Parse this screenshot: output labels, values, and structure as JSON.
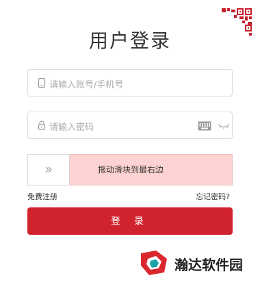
{
  "page": {
    "title": "用户登录"
  },
  "form": {
    "account_placeholder": "请输入账号/手机号",
    "password_placeholder": "请输入密码"
  },
  "slider": {
    "hint": "拖动滑块到最右边"
  },
  "links": {
    "register": "免费注册",
    "forgot": "忘记密码?"
  },
  "buttons": {
    "login": "登 录"
  },
  "watermark": {
    "brand": "瀚达软件园"
  },
  "colors": {
    "primary": "#d1232e",
    "slider_track": "#fcd2d2",
    "border": "#dcdcdc",
    "placeholder": "#aaaaaa"
  },
  "icons": {
    "qr": "qr-code-corner-icon",
    "account": "phone-icon",
    "password": "lock-icon",
    "keyboard": "keyboard-icon",
    "eye": "eye-closed-icon",
    "slider": "double-chevron-right-icon"
  }
}
